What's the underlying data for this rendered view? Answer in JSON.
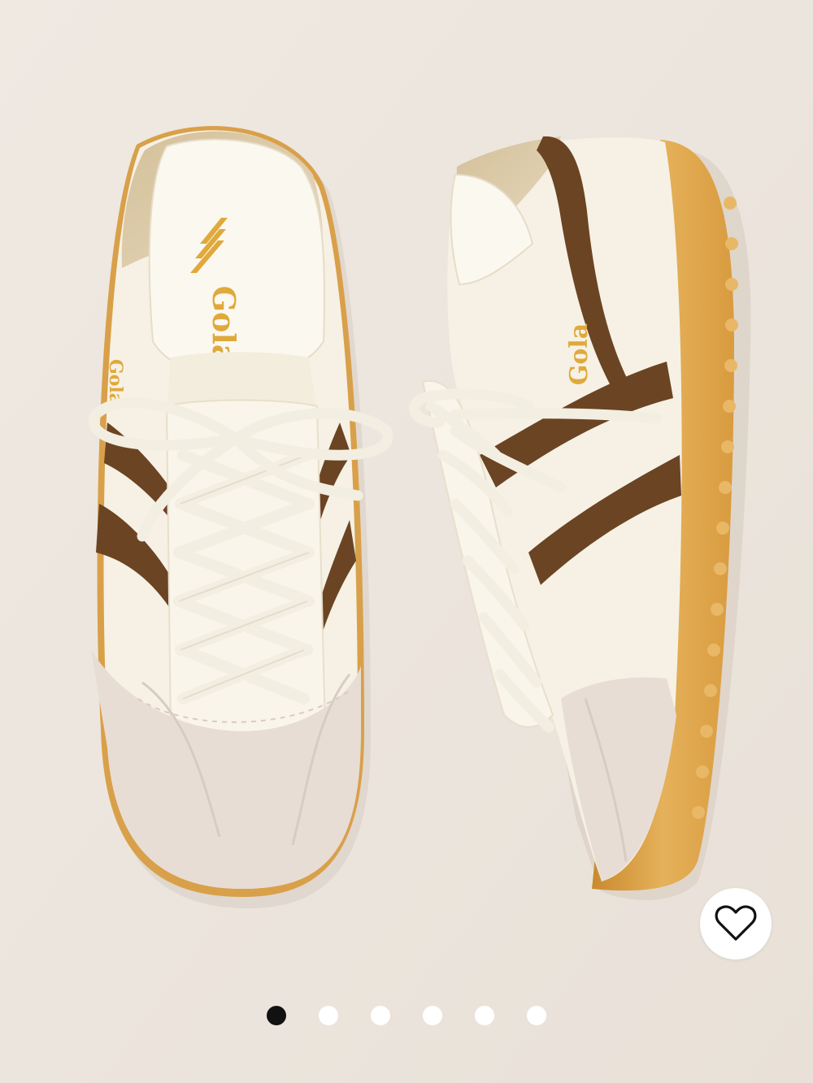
{
  "product_image": {
    "icon": "sneaker-pair-photo",
    "brand_text": "Gola",
    "colors": {
      "background": "#ede6de",
      "upper": "#f6f1e4",
      "stripe": "#6b4424",
      "suede": "#e8ddd4",
      "gum_sole": "#dca24a",
      "logo": "#e0a93b",
      "heel_tab": "#dac9a8"
    }
  },
  "wishlist": {
    "icon": "heart-outline-icon",
    "selected": false
  },
  "carousel": {
    "total_images": 6,
    "active_index": 0,
    "colors": {
      "active": "#111111",
      "inactive": "#ffffff"
    }
  }
}
